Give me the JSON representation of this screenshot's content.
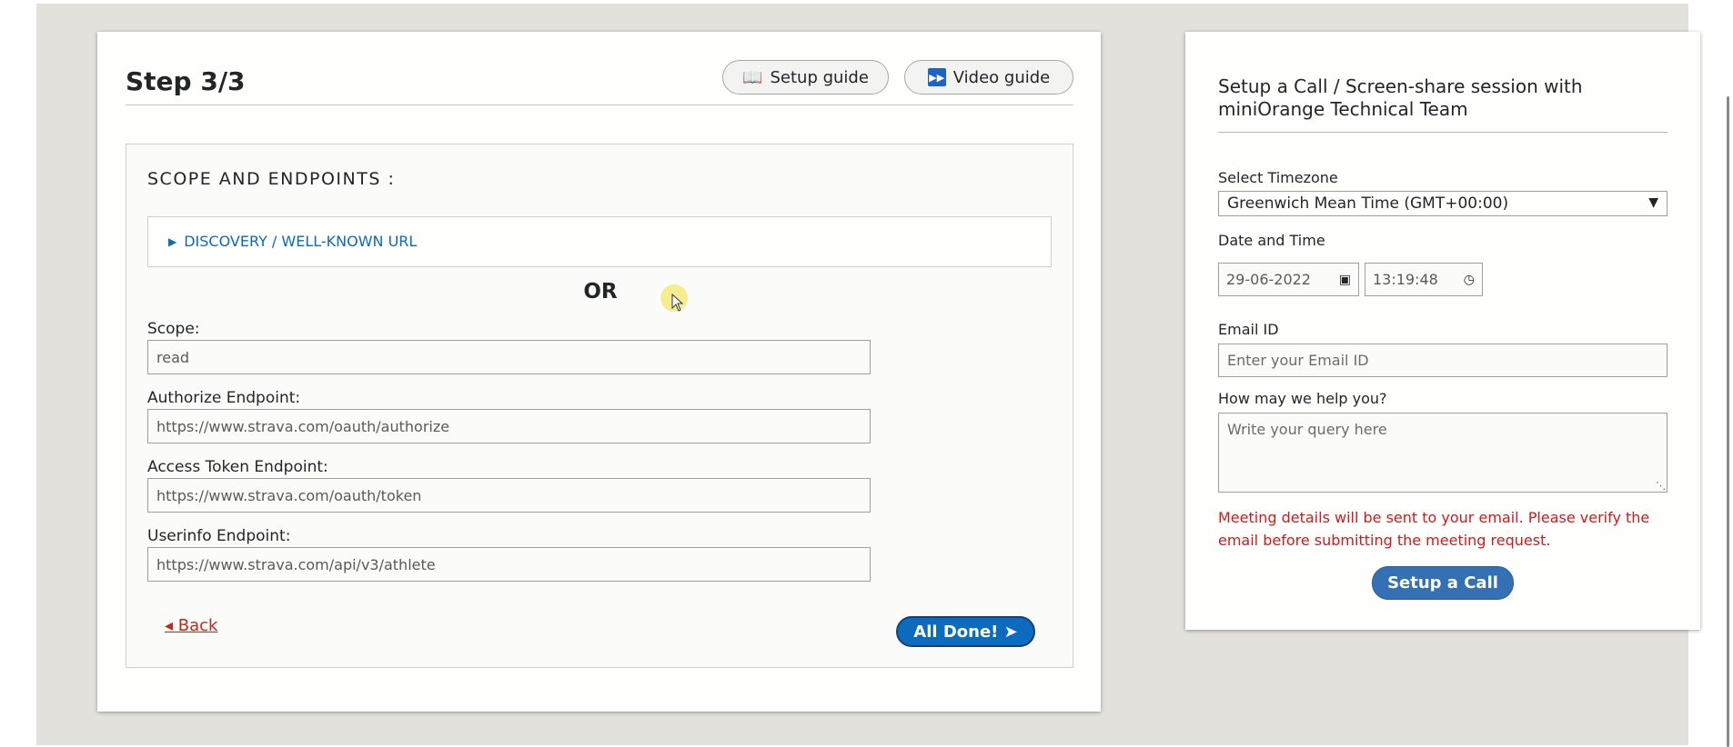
{
  "step": {
    "title": "Step 3/3",
    "setup_guide_label": "Setup guide",
    "video_guide_label": "Video guide"
  },
  "endpoints": {
    "heading": "SCOPE AND ENDPOINTS :",
    "discovery_label": "DISCOVERY / WELL-KNOWN URL",
    "or_text": "OR",
    "fields": [
      {
        "label": "Scope:",
        "value": "read"
      },
      {
        "label": "Authorize Endpoint:",
        "value": "https://www.strava.com/oauth/authorize"
      },
      {
        "label": "Access Token Endpoint:",
        "value": "https://www.strava.com/oauth/token"
      },
      {
        "label": "Userinfo Endpoint:",
        "value": "https://www.strava.com/api/v3/athlete"
      }
    ],
    "back_label": "◂ Back",
    "done_label": "All Done! ➤"
  },
  "call": {
    "title": "Setup a Call / Screen-share session with miniOrange Technical Team",
    "timezone_label": "Select Timezone",
    "timezone_value": "Greenwich Mean Time (GMT+00:00)",
    "datetime_label": "Date and Time",
    "date_value": "29-06-2022",
    "time_value": "13:19:48",
    "email_label": "Email ID",
    "email_placeholder": "Enter your Email ID",
    "query_label": "How may we help you?",
    "query_placeholder": "Write your query here",
    "warning": "Meeting details will be sent to your email. Please verify the email before submitting the meeting request.",
    "submit_label": "Setup a Call"
  },
  "icons": {
    "setup_guide": "book-icon",
    "video_guide": "play-icon",
    "discovery": "triangle-right-icon",
    "timezone": "chevron-down-icon",
    "date": "calendar-icon",
    "time": "clock-icon"
  },
  "colors": {
    "primary": "#0a6bbf",
    "call_button": "#3470b4",
    "warning": "#d21a1a",
    "back_link": "#c1281c",
    "page_background": "#e2e1dc"
  }
}
